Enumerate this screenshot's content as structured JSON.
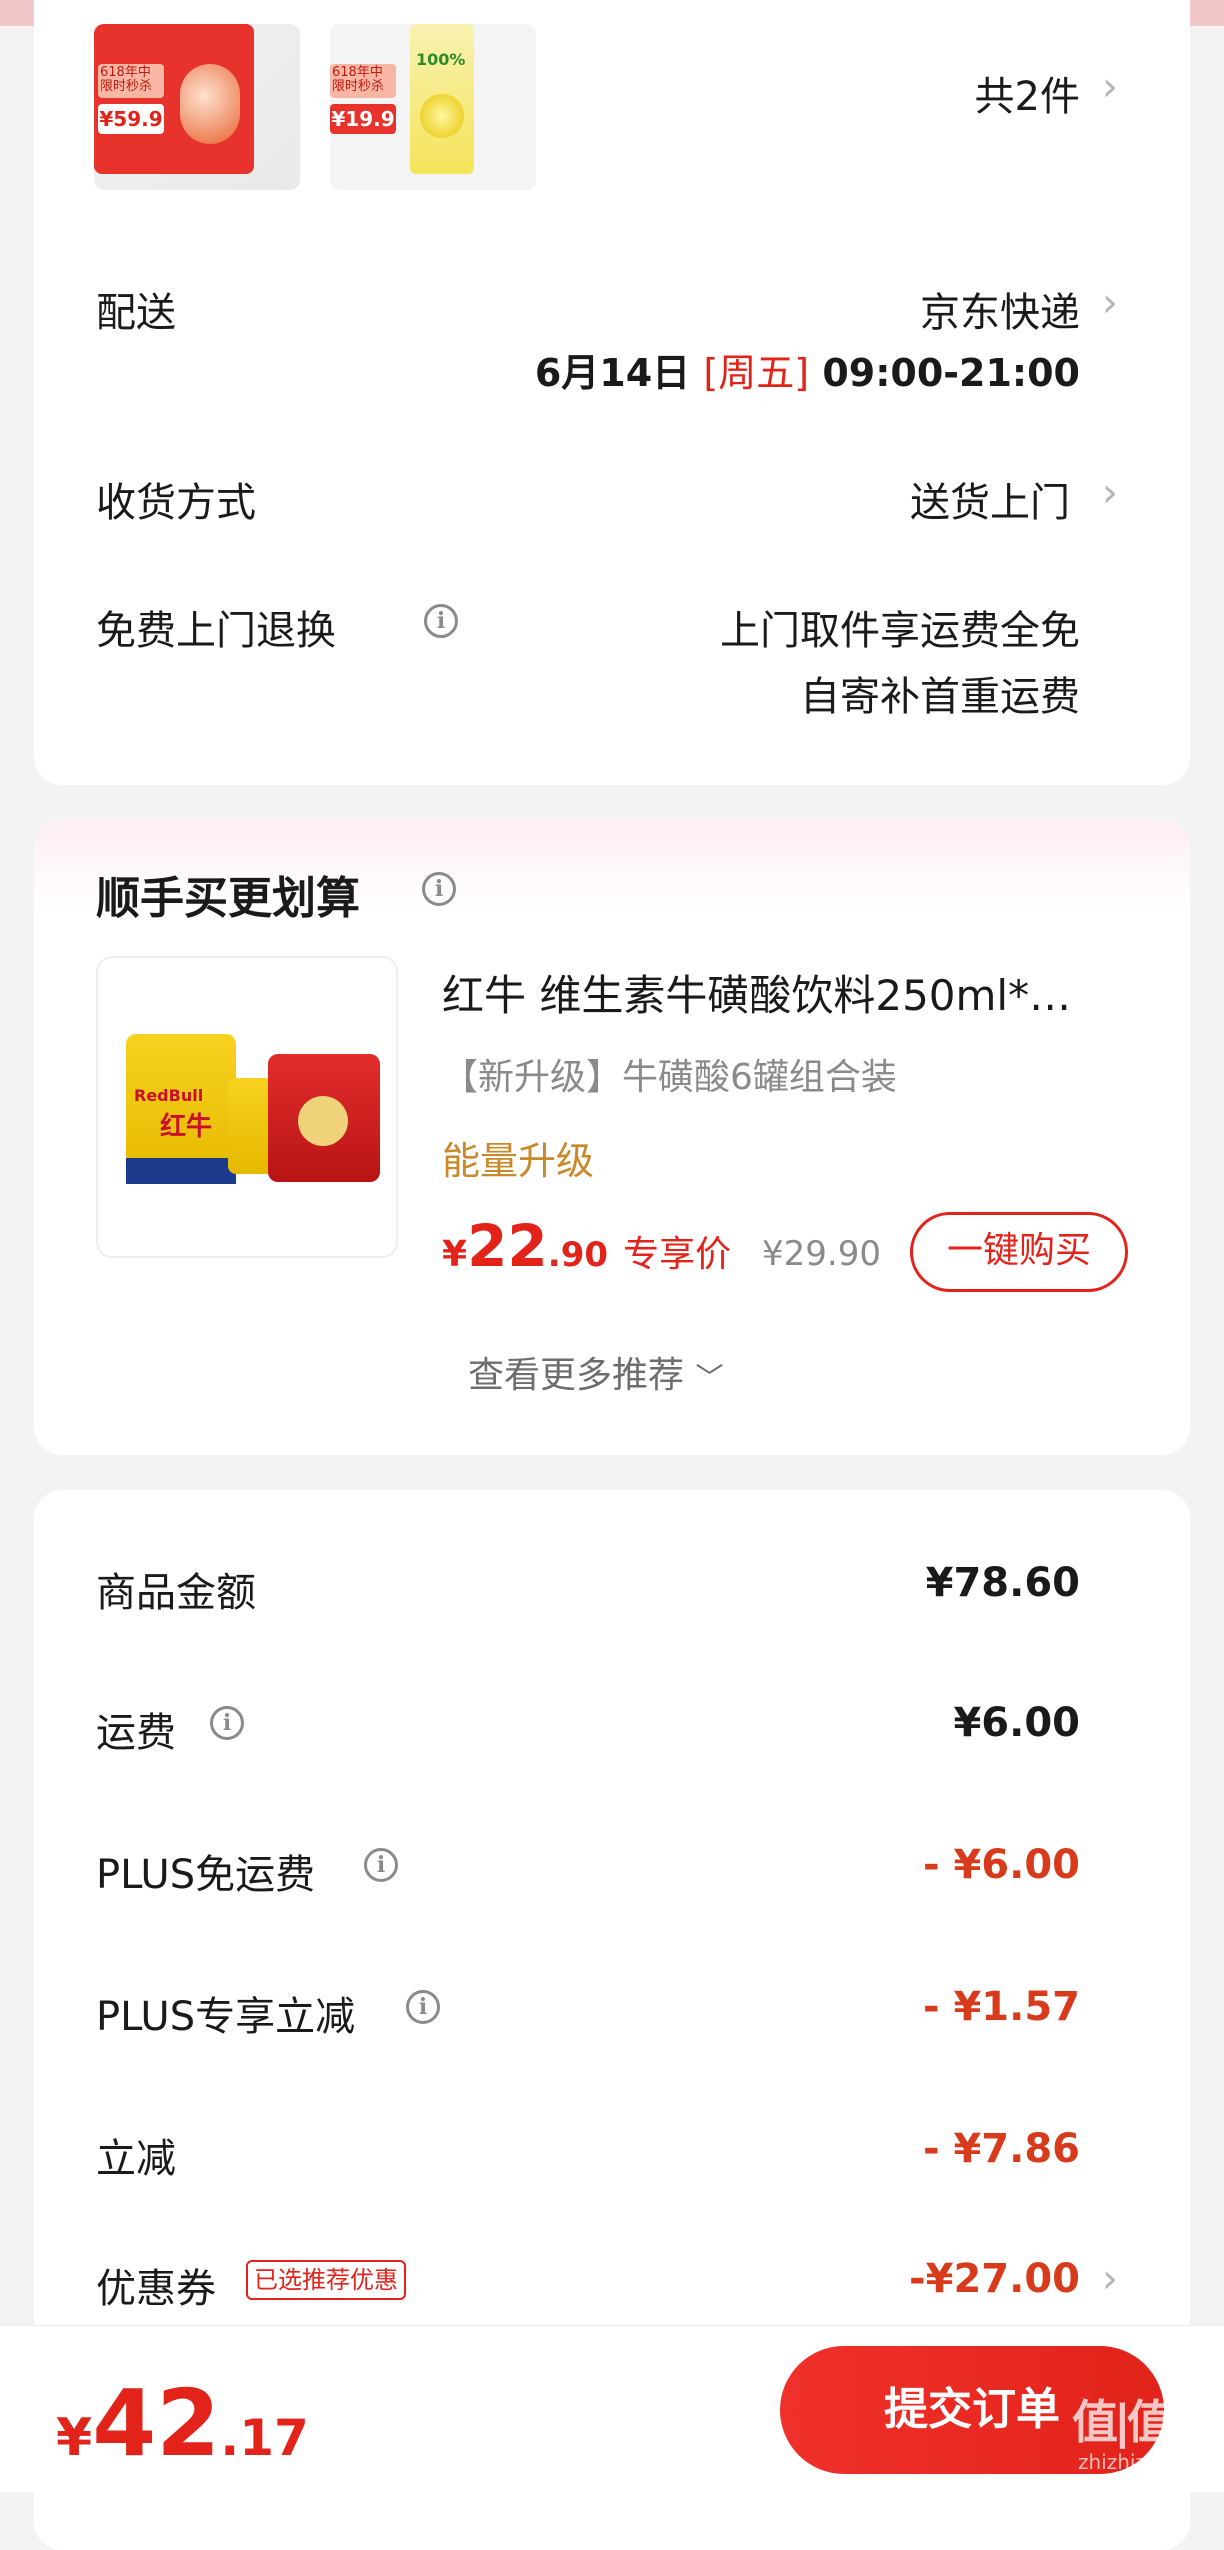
{
  "goods": {
    "item1": {
      "tag": "618年中 限时秒杀",
      "price": "¥59.9"
    },
    "item2": {
      "tag": "618年中 限时秒杀",
      "price": "¥19.9",
      "juice_label": "100%"
    },
    "count_label": "共2件"
  },
  "delivery": {
    "label": "配送",
    "carrier": "京东快递",
    "date": "6月14日",
    "weekday": "[周五]",
    "time": "09:00-21:00"
  },
  "receive": {
    "label": "收货方式",
    "value": "送货上门"
  },
  "free_return": {
    "label": "免费上门退换",
    "line1": "上门取件享运费全免",
    "line2": "自寄补首重运费"
  },
  "recommend": {
    "title": "顺手买更划算",
    "product": {
      "name": "红牛 维生素牛磺酸饮料250ml*…",
      "subtitle": "【新升级】牛磺酸6罐组合装",
      "tag": "能量升级",
      "price_symbol": "¥",
      "price_int": "22",
      "price_dec": ".90",
      "price_label": "专享价",
      "original_price": "¥29.90",
      "buy_button": "一键购买",
      "can_brand": "RedBull",
      "can_text": "红牛"
    },
    "more": "查看更多推荐"
  },
  "summary": {
    "rows": [
      {
        "label": "商品金额",
        "value": "¥78.60"
      },
      {
        "label": "运费",
        "value": "¥6.00"
      },
      {
        "label": "PLUS免运费",
        "value": "- ¥6.00"
      },
      {
        "label": "PLUS专享立减",
        "value": "- ¥1.57"
      },
      {
        "label": "立减",
        "value": "- ¥7.86"
      },
      {
        "label": "优惠券",
        "badge": "已选推荐优惠",
        "value": "-¥27.00"
      }
    ]
  },
  "footer": {
    "total_symbol": "¥",
    "total_int": "42",
    "total_dec": ".17",
    "submit": "提交订单",
    "watermark": "值|值|值",
    "watermark_url": "zhizhizhi.com"
  },
  "colors": {
    "accent": "#e2231a",
    "tag_orange": "#c8892a",
    "gray_text": "#8a8a8a"
  }
}
